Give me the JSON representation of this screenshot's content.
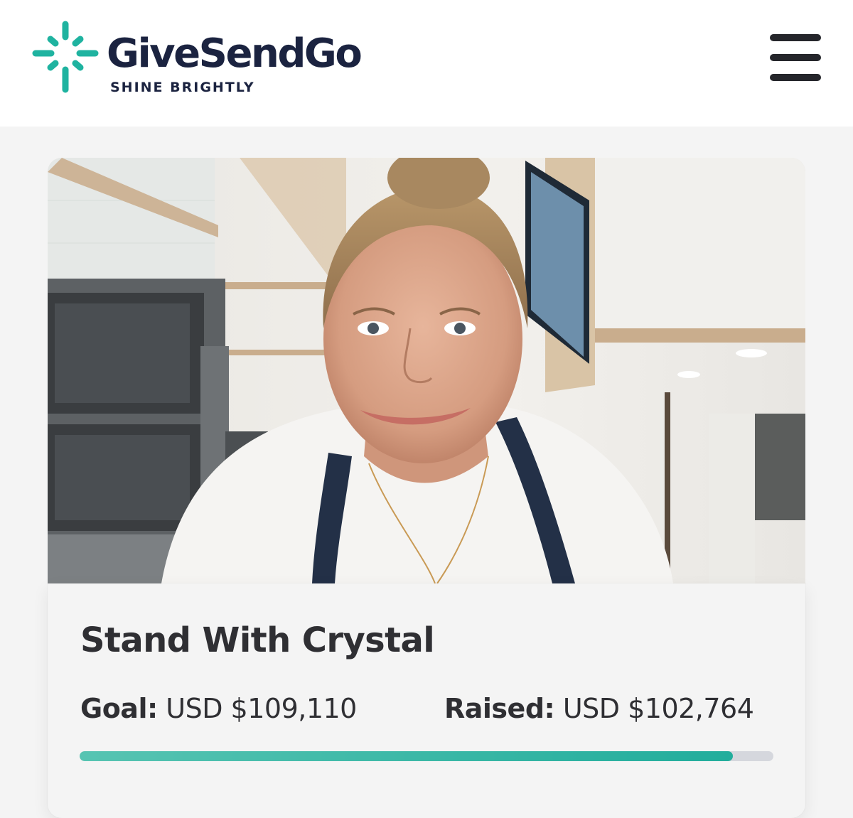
{
  "brand": {
    "name": "GiveSendGo",
    "tagline": "SHINE BRIGHTLY",
    "logo_icon": "starburst-logo-icon",
    "accent_color": "#1fb3a0",
    "text_color": "#1b2340"
  },
  "header": {
    "menu_icon": "hamburger-menu-icon"
  },
  "campaign": {
    "title": "Stand With Crystal",
    "goal_label": "Goal:",
    "goal_value": "USD $109,110",
    "raised_label": "Raised:",
    "raised_value": "USD $102,764",
    "progress_fraction": 0.942
  }
}
